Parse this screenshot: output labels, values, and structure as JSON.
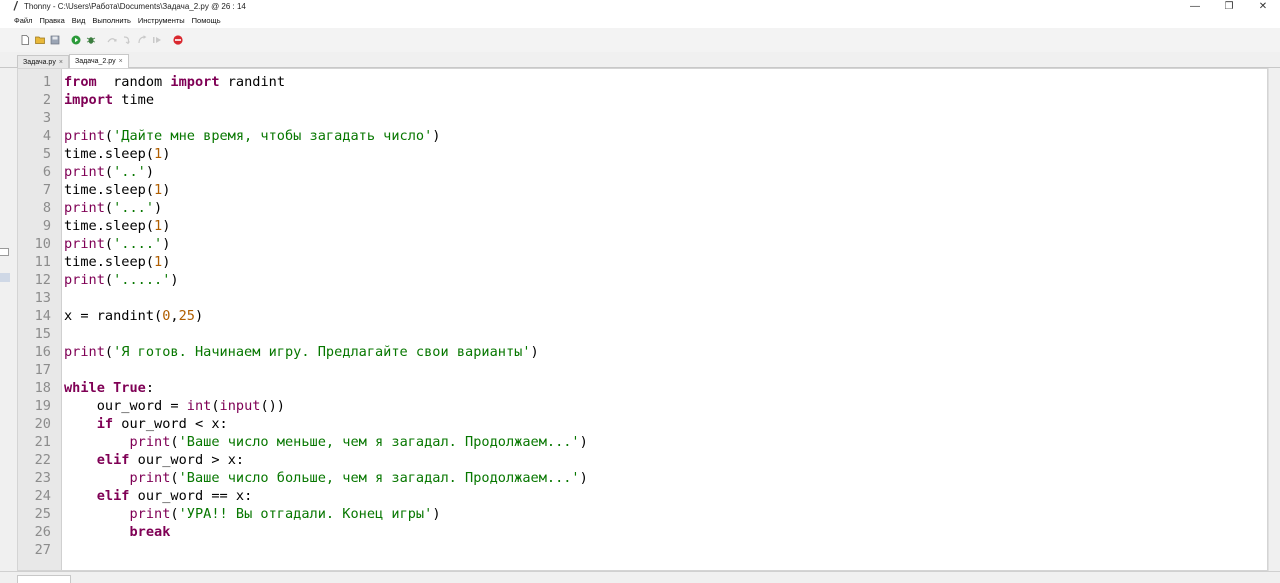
{
  "window": {
    "title": "Thonny  -  C:\\Users\\Работа\\Documents\\Задача_2.py  @  26 : 14",
    "controls": [
      "—",
      "❐",
      "✕"
    ]
  },
  "menu": [
    "Файл",
    "Правка",
    "Вид",
    "Выполнить",
    "Инструменты",
    "Помощь"
  ],
  "toolbar": {
    "icons": [
      "new-file-icon",
      "open-file-icon",
      "save-file-icon",
      "run-icon",
      "debug-icon",
      "step-over-icon",
      "step-into-icon",
      "step-out-icon",
      "resume-icon",
      "stop-icon"
    ]
  },
  "tabs": [
    {
      "label": "Задача.py",
      "close": "×",
      "active": false
    },
    {
      "label": "Задача_2.py",
      "close": "×",
      "active": true
    }
  ],
  "editor": {
    "line_numbers": [
      "1",
      "2",
      "3",
      "4",
      "5",
      "6",
      "7",
      "8",
      "9",
      "10",
      "11",
      "12",
      "13",
      "14",
      "15",
      "16",
      "17",
      "18",
      "19",
      "20",
      "21",
      "22",
      "23",
      "24",
      "25",
      "26",
      "27"
    ],
    "lines": [
      [
        [
          "kw",
          "from"
        ],
        [
          "",
          "  random "
        ],
        [
          "kw",
          "import"
        ],
        [
          "",
          " randint"
        ]
      ],
      [
        [
          "kw",
          "import"
        ],
        [
          "",
          " time"
        ]
      ],
      [],
      [
        [
          "bi",
          "print"
        ],
        [
          "",
          "("
        ],
        [
          "str",
          "'Дайте мне время, чтобы загадать число'"
        ],
        [
          "",
          ")"
        ]
      ],
      [
        [
          "",
          "time.sleep("
        ],
        [
          "num",
          "1"
        ],
        [
          "",
          ")"
        ]
      ],
      [
        [
          "bi",
          "print"
        ],
        [
          "",
          "("
        ],
        [
          "str",
          "'..'"
        ],
        [
          "",
          ")"
        ]
      ],
      [
        [
          "",
          "time.sleep("
        ],
        [
          "num",
          "1"
        ],
        [
          "",
          ")"
        ]
      ],
      [
        [
          "bi",
          "print"
        ],
        [
          "",
          "("
        ],
        [
          "str",
          "'...'"
        ],
        [
          "",
          ")"
        ]
      ],
      [
        [
          "",
          "time.sleep("
        ],
        [
          "num",
          "1"
        ],
        [
          "",
          ")"
        ]
      ],
      [
        [
          "bi",
          "print"
        ],
        [
          "",
          "("
        ],
        [
          "str",
          "'....'"
        ],
        [
          "",
          ")"
        ]
      ],
      [
        [
          "",
          "time.sleep("
        ],
        [
          "num",
          "1"
        ],
        [
          "",
          ")"
        ]
      ],
      [
        [
          "bi",
          "print"
        ],
        [
          "",
          "("
        ],
        [
          "str",
          "'.....'"
        ],
        [
          "",
          ")"
        ]
      ],
      [],
      [
        [
          "",
          "x = randint("
        ],
        [
          "num",
          "0"
        ],
        [
          "",
          ","
        ],
        [
          "num",
          "25"
        ],
        [
          "",
          ")"
        ]
      ],
      [],
      [
        [
          "bi",
          "print"
        ],
        [
          "",
          "("
        ],
        [
          "str",
          "'Я готов. Начинаем игру. Предлагайте свои варианты'"
        ],
        [
          "",
          ")"
        ]
      ],
      [],
      [
        [
          "kw",
          "while"
        ],
        [
          "",
          " "
        ],
        [
          "kw",
          "True"
        ],
        [
          "",
          ":"
        ]
      ],
      [
        [
          "",
          "    our_word = "
        ],
        [
          "bi",
          "int"
        ],
        [
          "",
          "("
        ],
        [
          "bi",
          "input"
        ],
        [
          "",
          "())"
        ]
      ],
      [
        [
          "",
          "    "
        ],
        [
          "kw",
          "if"
        ],
        [
          "",
          " our_word < x:"
        ]
      ],
      [
        [
          "",
          "        "
        ],
        [
          "bi",
          "print"
        ],
        [
          "",
          "("
        ],
        [
          "str",
          "'Ваше число меньше, чем я загадал. Продолжаем...'"
        ],
        [
          "",
          ")"
        ]
      ],
      [
        [
          "",
          "    "
        ],
        [
          "kw",
          "elif"
        ],
        [
          "",
          " our_word > x:"
        ]
      ],
      [
        [
          "",
          "        "
        ],
        [
          "bi",
          "print"
        ],
        [
          "",
          "("
        ],
        [
          "str",
          "'Ваше число больше, чем я загадал. Продолжаем...'"
        ],
        [
          "",
          ")"
        ]
      ],
      [
        [
          "",
          "    "
        ],
        [
          "kw",
          "elif"
        ],
        [
          "",
          " our_word == x:"
        ]
      ],
      [
        [
          "",
          "        "
        ],
        [
          "bi",
          "print"
        ],
        [
          "",
          "("
        ],
        [
          "str",
          "'УРА!! Вы отгадали. Конец игры'"
        ],
        [
          "",
          ")"
        ]
      ],
      [
        [
          "",
          "        "
        ],
        [
          "kw",
          "break"
        ]
      ],
      []
    ]
  }
}
